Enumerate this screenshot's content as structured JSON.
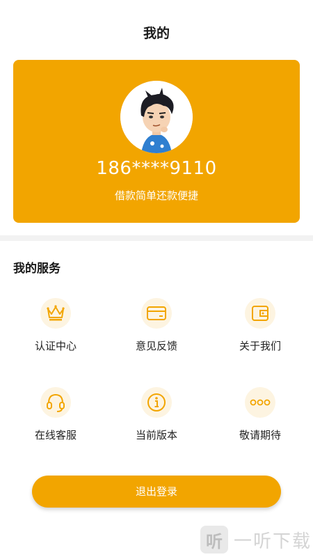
{
  "header": {
    "title": "我的"
  },
  "profile": {
    "phone": "186****9110",
    "tagline": "借款简单还款便捷"
  },
  "services": {
    "title": "我的服务",
    "items": [
      {
        "label": "认证中心",
        "icon": "crown-icon"
      },
      {
        "label": "意见反馈",
        "icon": "card-icon"
      },
      {
        "label": "关于我们",
        "icon": "wallet-icon"
      },
      {
        "label": "在线客服",
        "icon": "headset-icon"
      },
      {
        "label": "当前版本",
        "icon": "info-icon"
      },
      {
        "label": "敬请期待",
        "icon": "more-icon"
      }
    ]
  },
  "logout": {
    "label": "退出登录"
  },
  "watermark": {
    "glyph": "听",
    "text": "一听下载"
  },
  "colors": {
    "accent": "#f2a500",
    "icon_bg": "#fdf4e1",
    "divider": "#f2f2f2"
  }
}
